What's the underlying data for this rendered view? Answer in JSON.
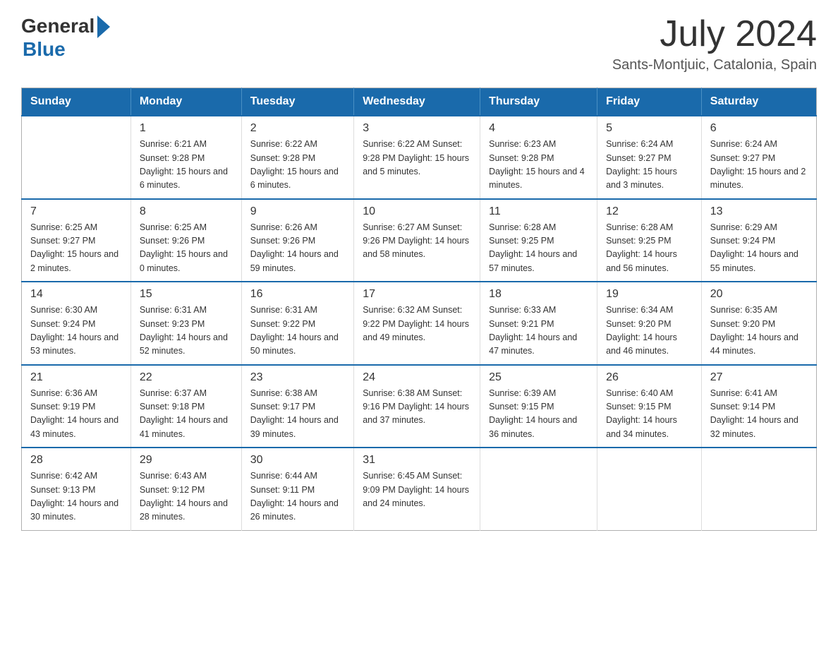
{
  "logo": {
    "general": "General",
    "blue": "Blue"
  },
  "header": {
    "month_year": "July 2024",
    "location": "Sants-Montjuic, Catalonia, Spain"
  },
  "days_of_week": [
    "Sunday",
    "Monday",
    "Tuesday",
    "Wednesday",
    "Thursday",
    "Friday",
    "Saturday"
  ],
  "weeks": [
    [
      {
        "day": "",
        "info": ""
      },
      {
        "day": "1",
        "info": "Sunrise: 6:21 AM\nSunset: 9:28 PM\nDaylight: 15 hours\nand 6 minutes."
      },
      {
        "day": "2",
        "info": "Sunrise: 6:22 AM\nSunset: 9:28 PM\nDaylight: 15 hours\nand 6 minutes."
      },
      {
        "day": "3",
        "info": "Sunrise: 6:22 AM\nSunset: 9:28 PM\nDaylight: 15 hours\nand 5 minutes."
      },
      {
        "day": "4",
        "info": "Sunrise: 6:23 AM\nSunset: 9:28 PM\nDaylight: 15 hours\nand 4 minutes."
      },
      {
        "day": "5",
        "info": "Sunrise: 6:24 AM\nSunset: 9:27 PM\nDaylight: 15 hours\nand 3 minutes."
      },
      {
        "day": "6",
        "info": "Sunrise: 6:24 AM\nSunset: 9:27 PM\nDaylight: 15 hours\nand 2 minutes."
      }
    ],
    [
      {
        "day": "7",
        "info": "Sunrise: 6:25 AM\nSunset: 9:27 PM\nDaylight: 15 hours\nand 2 minutes."
      },
      {
        "day": "8",
        "info": "Sunrise: 6:25 AM\nSunset: 9:26 PM\nDaylight: 15 hours\nand 0 minutes."
      },
      {
        "day": "9",
        "info": "Sunrise: 6:26 AM\nSunset: 9:26 PM\nDaylight: 14 hours\nand 59 minutes."
      },
      {
        "day": "10",
        "info": "Sunrise: 6:27 AM\nSunset: 9:26 PM\nDaylight: 14 hours\nand 58 minutes."
      },
      {
        "day": "11",
        "info": "Sunrise: 6:28 AM\nSunset: 9:25 PM\nDaylight: 14 hours\nand 57 minutes."
      },
      {
        "day": "12",
        "info": "Sunrise: 6:28 AM\nSunset: 9:25 PM\nDaylight: 14 hours\nand 56 minutes."
      },
      {
        "day": "13",
        "info": "Sunrise: 6:29 AM\nSunset: 9:24 PM\nDaylight: 14 hours\nand 55 minutes."
      }
    ],
    [
      {
        "day": "14",
        "info": "Sunrise: 6:30 AM\nSunset: 9:24 PM\nDaylight: 14 hours\nand 53 minutes."
      },
      {
        "day": "15",
        "info": "Sunrise: 6:31 AM\nSunset: 9:23 PM\nDaylight: 14 hours\nand 52 minutes."
      },
      {
        "day": "16",
        "info": "Sunrise: 6:31 AM\nSunset: 9:22 PM\nDaylight: 14 hours\nand 50 minutes."
      },
      {
        "day": "17",
        "info": "Sunrise: 6:32 AM\nSunset: 9:22 PM\nDaylight: 14 hours\nand 49 minutes."
      },
      {
        "day": "18",
        "info": "Sunrise: 6:33 AM\nSunset: 9:21 PM\nDaylight: 14 hours\nand 47 minutes."
      },
      {
        "day": "19",
        "info": "Sunrise: 6:34 AM\nSunset: 9:20 PM\nDaylight: 14 hours\nand 46 minutes."
      },
      {
        "day": "20",
        "info": "Sunrise: 6:35 AM\nSunset: 9:20 PM\nDaylight: 14 hours\nand 44 minutes."
      }
    ],
    [
      {
        "day": "21",
        "info": "Sunrise: 6:36 AM\nSunset: 9:19 PM\nDaylight: 14 hours\nand 43 minutes."
      },
      {
        "day": "22",
        "info": "Sunrise: 6:37 AM\nSunset: 9:18 PM\nDaylight: 14 hours\nand 41 minutes."
      },
      {
        "day": "23",
        "info": "Sunrise: 6:38 AM\nSunset: 9:17 PM\nDaylight: 14 hours\nand 39 minutes."
      },
      {
        "day": "24",
        "info": "Sunrise: 6:38 AM\nSunset: 9:16 PM\nDaylight: 14 hours\nand 37 minutes."
      },
      {
        "day": "25",
        "info": "Sunrise: 6:39 AM\nSunset: 9:15 PM\nDaylight: 14 hours\nand 36 minutes."
      },
      {
        "day": "26",
        "info": "Sunrise: 6:40 AM\nSunset: 9:15 PM\nDaylight: 14 hours\nand 34 minutes."
      },
      {
        "day": "27",
        "info": "Sunrise: 6:41 AM\nSunset: 9:14 PM\nDaylight: 14 hours\nand 32 minutes."
      }
    ],
    [
      {
        "day": "28",
        "info": "Sunrise: 6:42 AM\nSunset: 9:13 PM\nDaylight: 14 hours\nand 30 minutes."
      },
      {
        "day": "29",
        "info": "Sunrise: 6:43 AM\nSunset: 9:12 PM\nDaylight: 14 hours\nand 28 minutes."
      },
      {
        "day": "30",
        "info": "Sunrise: 6:44 AM\nSunset: 9:11 PM\nDaylight: 14 hours\nand 26 minutes."
      },
      {
        "day": "31",
        "info": "Sunrise: 6:45 AM\nSunset: 9:09 PM\nDaylight: 14 hours\nand 24 minutes."
      },
      {
        "day": "",
        "info": ""
      },
      {
        "day": "",
        "info": ""
      },
      {
        "day": "",
        "info": ""
      }
    ]
  ]
}
